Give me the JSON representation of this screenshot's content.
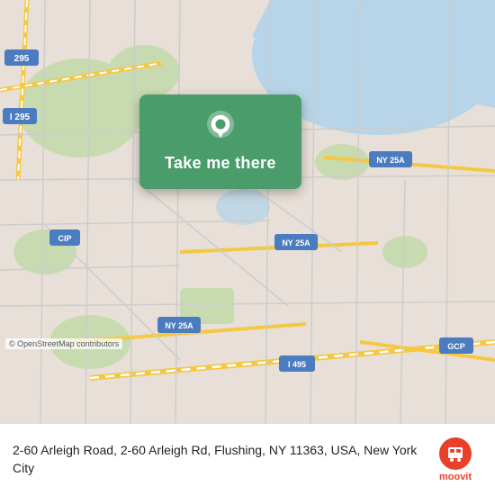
{
  "map": {
    "attribution": "© OpenStreetMap contributors",
    "pin_location": "Flushing, NY"
  },
  "tooltip": {
    "button_label": "Take me there"
  },
  "bottom_bar": {
    "address": "2-60 Arleigh Road, 2-60 Arleigh Rd, Flushing, NY 11363, USA, New York City"
  },
  "moovit": {
    "label": "moovit"
  }
}
